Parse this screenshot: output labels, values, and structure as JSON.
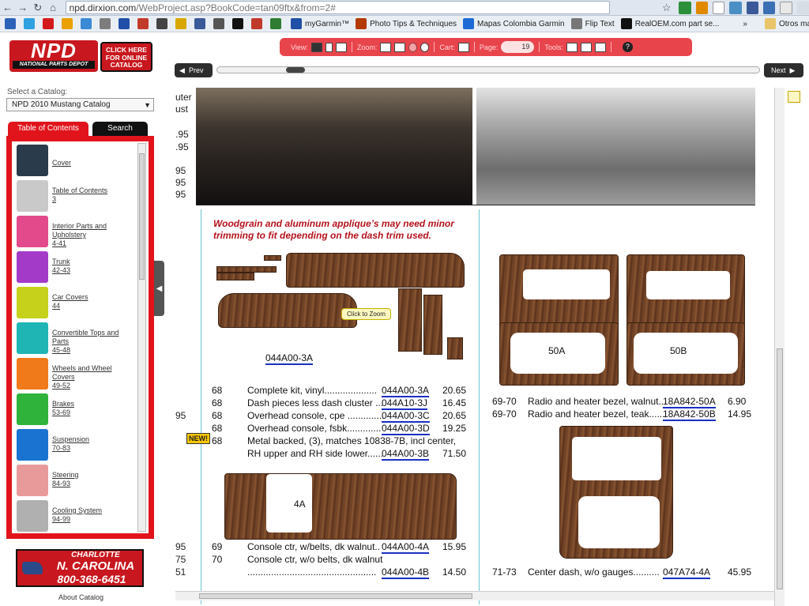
{
  "browser": {
    "url_host": "npd.dirxion.com",
    "url_path": "/WebProject.asp?BookCode=tan09ftx&from=2#",
    "bookmarks": [
      {
        "label": "",
        "color": "#2c63b8"
      },
      {
        "label": "",
        "color": "#2fa1e0"
      },
      {
        "label": "",
        "color": "#d31a1a"
      },
      {
        "label": "",
        "color": "#e9a000"
      },
      {
        "label": "",
        "color": "#3a8ad6"
      },
      {
        "label": "",
        "color": "#7d7d7d"
      },
      {
        "label": "",
        "color": "#1f4fa6"
      },
      {
        "label": "",
        "color": "#c23a2a"
      },
      {
        "label": "",
        "color": "#444444"
      },
      {
        "label": "",
        "color": "#d9a800"
      },
      {
        "label": "",
        "color": "#3b5998"
      },
      {
        "label": "",
        "color": "#555555"
      },
      {
        "label": "",
        "color": "#111111"
      },
      {
        "label": "",
        "color": "#c0392b"
      },
      {
        "label": "",
        "color": "#2e7d32"
      }
    ],
    "named_bookmarks": [
      {
        "label": "myGarmin™",
        "color": "#1f4fa6"
      },
      {
        "label": "Photo Tips & Techniques",
        "color": "#b33a00"
      },
      {
        "label": "Mapas Colombia Garmin",
        "color": "#1e6ad4"
      },
      {
        "label": "Flip Text",
        "color": "#777777"
      },
      {
        "label": "RealOEM.com part se...",
        "color": "#111111"
      }
    ],
    "other_bookmarks": "Otros marcadores"
  },
  "sidebar": {
    "logo_main": "NPD",
    "logo_sub": "NATIONAL PARTS DEPOT",
    "click_catalog": [
      "CLICK HERE",
      "FOR ONLINE",
      "CATALOG"
    ],
    "select_label": "Select a Catalog:",
    "catalog_value": "NPD 2010 Mustang Catalog",
    "tab_toc": "Table of Contents",
    "tab_search": "Search",
    "toc": [
      {
        "title": "Cover",
        "pages": "",
        "color": "#2a3b4c"
      },
      {
        "title": "Table of Contents",
        "pages": "3",
        "color": "#c9c9c9"
      },
      {
        "title": "Interior Parts and Upholstery",
        "pages": "4-41",
        "color": "#e24a8c"
      },
      {
        "title": "Trunk",
        "pages": "42-43",
        "color": "#a33bc8"
      },
      {
        "title": "Car Covers",
        "pages": "44",
        "color": "#c6d11c"
      },
      {
        "title": "Convertible Tops and Parts",
        "pages": "45-48",
        "color": "#1fb5b5"
      },
      {
        "title": "Wheels and Wheel Covers",
        "pages": "49-52",
        "color": "#f07a1a"
      },
      {
        "title": "Brakes",
        "pages": "53-69",
        "color": "#2fb33a"
      },
      {
        "title": "Suspension",
        "pages": "70-83",
        "color": "#1a73d1"
      },
      {
        "title": "Steering",
        "pages": "84-93",
        "color": "#e89a9a"
      },
      {
        "title": "Cooling System",
        "pages": "94-99",
        "color": "#b0b0b0"
      }
    ],
    "ad": {
      "line1": "CHARLOTTE",
      "line2": "N. CAROLINA",
      "line3": "800-368-6451"
    },
    "about": "About Catalog"
  },
  "toolbar": {
    "view_label": "View:",
    "zoom_label": "Zoom:",
    "cart_label": "Cart:",
    "page_label": "Page:",
    "page_value": "19",
    "tools_label": "Tools:",
    "help": "?"
  },
  "nav": {
    "prev": "Prev",
    "next": "Next",
    "page_slider_fraction": 0.08
  },
  "page": {
    "note": "Woodgrain and aluminum applique’s may need minor trimming to fit depending on the dash trim used.",
    "zoom_tip": "Click to Zoom",
    "new_badge": "NEW!",
    "left_fragments": [
      "uter",
      "ust",
      ".95",
      ".95",
      "95",
      "95",
      "95",
      "95",
      "95",
      "75",
      "51"
    ],
    "kit_label": "044A00-3A",
    "label_4a": "4A",
    "label_50a": "50A",
    "label_50b": "50B",
    "left_rows": [
      {
        "year": "68",
        "desc": "Complete kit, vinyl....................",
        "part": "044A00-3A",
        "price": "20.65"
      },
      {
        "year": "68",
        "desc": "Dash pieces less dash cluster ...",
        "part": "044A10-3J",
        "price": "16.45"
      },
      {
        "year": "68",
        "desc": "Overhead console, cpe ..............",
        "part": "044A00-3C",
        "price": "20.65"
      },
      {
        "year": "68",
        "desc": "Overhead console, fsbk.............",
        "part": "044A00-3D",
        "price": "19.25"
      },
      {
        "year": "68",
        "desc": "Metal backed, (3), matches 10838-7B, incl center,",
        "part": "",
        "price": ""
      },
      {
        "year": "",
        "desc": "RH upper and RH side lower......",
        "part": "044A00-3B",
        "price": "71.50"
      },
      {
        "year": "69",
        "desc": "Console ctr, w/belts, dk walnut..",
        "part": "044A00-4A",
        "price": "15.95"
      },
      {
        "year": "70",
        "desc": "Console ctr, w/o belts, dk walnut",
        "part": "",
        "price": ""
      },
      {
        "year": "",
        "desc": ".................................................",
        "part": "044A00-4B",
        "price": "14.50"
      }
    ],
    "right_rows": [
      {
        "year": "69-70",
        "desc": "Radio and heater bezel, walnut..",
        "part": "18A842-50A",
        "price": "6.90"
      },
      {
        "year": "69-70",
        "desc": "Radio and heater bezel, teak......",
        "part": "18A842-50B",
        "price": "14.95"
      },
      {
        "year": "71-73",
        "desc": "Center dash, w/o gauges..........",
        "part": "047A74-4A",
        "price": "45.95"
      }
    ]
  }
}
